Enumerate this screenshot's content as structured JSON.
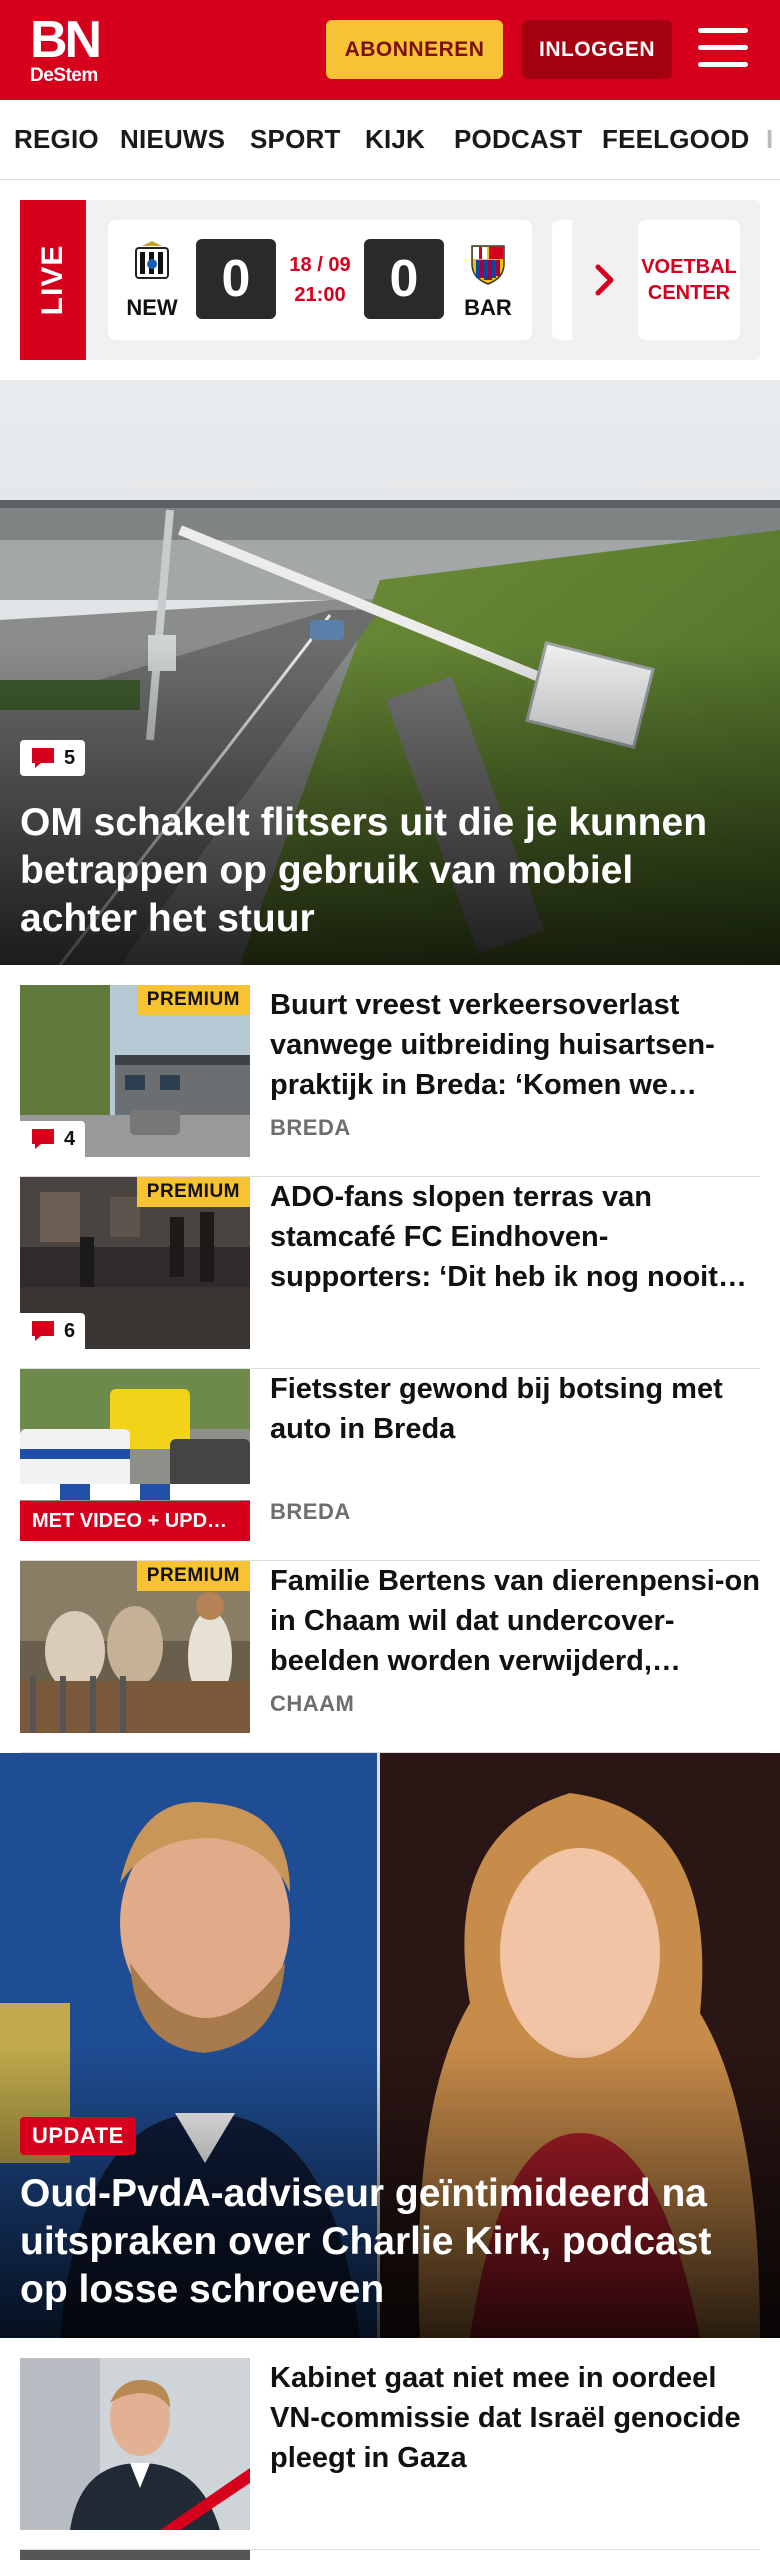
{
  "header": {
    "logo_main": "BN",
    "logo_sub": "DeStem",
    "subscribe_label": "ABONNEREN",
    "login_label": "INLOGGEN",
    "brand_color": "#d6001c",
    "menu_icon": "hamburger-menu-icon"
  },
  "nav": {
    "items": [
      "REGIO",
      "NIEUWS",
      "SPORT",
      "KIJK",
      "PODCAST",
      "FEELGOOD"
    ]
  },
  "live": {
    "label": "LIVE",
    "match": {
      "home_abbr": "NEW",
      "away_abbr": "BAR",
      "home_score": "0",
      "away_score": "0",
      "date": "18 / 09",
      "time": "21:00"
    },
    "center_label_line1": "VOETBAL",
    "center_label_line2": "CENTER"
  },
  "hero": {
    "comments": "5",
    "title": "OM schakelt flitsers uit die je kunnen betrappen op gebruik van mobiel achter het stuur"
  },
  "articles": [
    {
      "premium": "PREMIUM",
      "comments": "4",
      "title": "Buurt vreest verkeersoverlast vanwege uitbreiding huisartsen-praktijk in Breda: ‘Komen we…",
      "location": "BREDA"
    },
    {
      "premium": "PREMIUM",
      "comments": "6",
      "title": "ADO-fans slopen terras van stamcafé FC Eindhoven-supporters: ‘Dit heb ik nog nooit…",
      "location": ""
    },
    {
      "video_badge": "MET VIDEO + UPD…",
      "title": "Fietsster gewond bij botsing met auto in Breda",
      "location": "BREDA"
    },
    {
      "premium": "PREMIUM",
      "title": "Familie Bertens van dierenpensi-on in Chaam wil dat undercover-beelden worden verwijderd,…",
      "location": "CHAAM"
    }
  ],
  "hero2": {
    "badge": "UPDATE",
    "title": "Oud-PvdA-adviseur geïntimideerd na uitspraken over Charlie Kirk, podcast op losse schroeven"
  },
  "article_last": {
    "title": "Kabinet gaat niet mee in oordeel VN-commissie dat Israël genocide pleegt in Gaza"
  }
}
